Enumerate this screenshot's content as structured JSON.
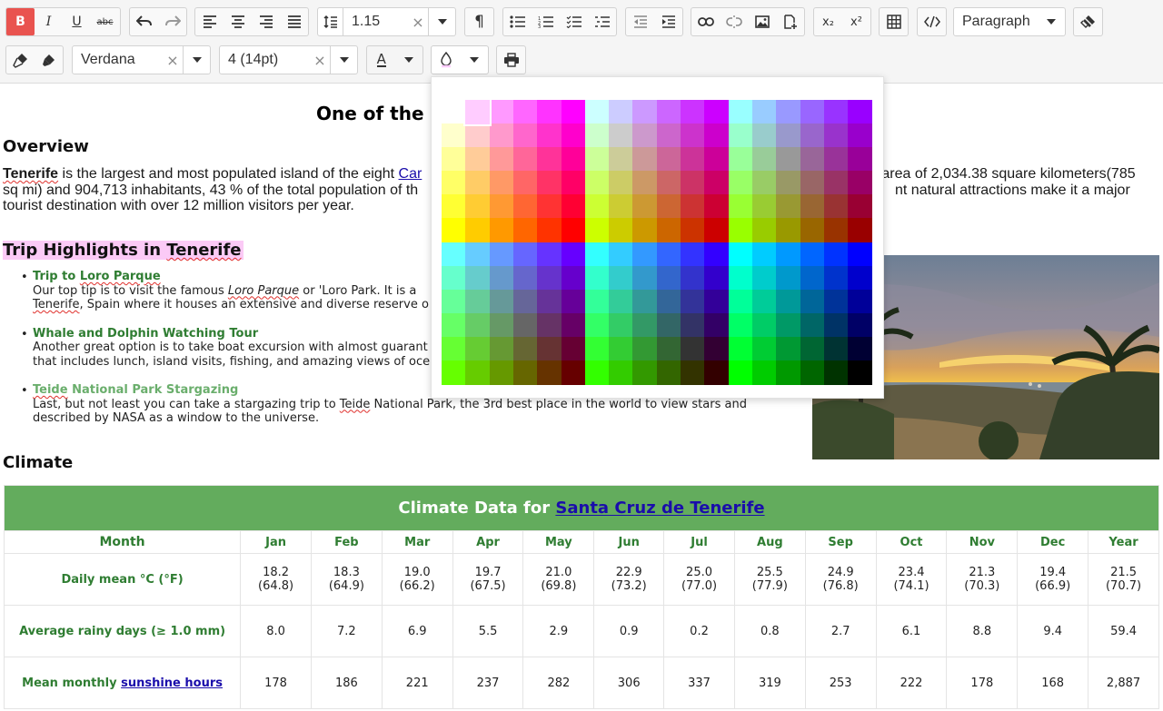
{
  "toolbar": {
    "row1": {
      "line_height_value": "1.15",
      "block_format": "Paragraph"
    },
    "row2": {
      "font_family": "Verdana",
      "font_size": "4 (14pt)",
      "font_color_glyph": "A"
    },
    "icons": {
      "bold": "B",
      "italic": "I",
      "underline": "U",
      "strike": "abc",
      "paragraph_mark": "¶",
      "subscript": "x₂",
      "superscript": "x²",
      "clear": "×"
    }
  },
  "document": {
    "title": "One of the l",
    "overview_heading": "Overview",
    "overview_paragraph": {
      "line1_a": "Tenerife",
      "line1_b": " is the largest and most populated island of the eight ",
      "line1_link": "Car",
      "line1_c": "d area of 2,034.38 square kilometers(785",
      "line2_a": "sq mi) and 904,713 inhabitants, 43 % of the total population of th",
      "line2_b": "nt natural attractions make it a major",
      "line3": "tourist destination with over 12 million visitors per year."
    },
    "highlights_heading": {
      "prefix": "Trip Highlights in ",
      "place": "Tenerife"
    },
    "highlights": [
      {
        "title_a": "Trip to ",
        "title_b": "Loro Parque",
        "line1_a": "Our top tip is to visit the famous ",
        "line1_italic": "Loro Parque",
        "line1_b": " or 'Loro Park. It is a",
        "line2_a": "Tenerife",
        "line2_b": ", Spain where it houses an extensive and diverse reserve o"
      },
      {
        "title": "Whale and Dolphin Watching Tour",
        "line1": "Another great option is to take boat excursion with almost guarant",
        "line2": "that includes lunch, island visits, fishing, and amazing views of oce"
      },
      {
        "title_a": "Teide",
        "title_b": " National Park Stargazing",
        "line1_a": "Last, but not least you can take a stargazing trip to ",
        "line1_b": "Teide",
        "line1_c": " National Park, the 3rd best place in the world to view stars and",
        "line2": "described by NASA as a window to the universe."
      }
    ],
    "climate_heading": "Climate",
    "climate_table": {
      "caption_prefix": "Climate Data for ",
      "caption_link": "Santa Cruz de Tenerife",
      "header_first": "Month",
      "months": [
        "Jan",
        "Feb",
        "Mar",
        "Apr",
        "May",
        "Jun",
        "Jul",
        "Aug",
        "Sep",
        "Oct",
        "Nov",
        "Dec",
        "Year"
      ],
      "rows": [
        {
          "label": "Daily mean °C (°F)",
          "cells": [
            [
              "18.2",
              "(64.8)"
            ],
            [
              "18.3",
              "(64.9)"
            ],
            [
              "19.0",
              "(66.2)"
            ],
            [
              "19.7",
              "(67.5)"
            ],
            [
              "21.0",
              "(69.8)"
            ],
            [
              "22.9",
              "(73.2)"
            ],
            [
              "25.0",
              "(77.0)"
            ],
            [
              "25.5",
              "(77.9)"
            ],
            [
              "24.9",
              "(76.8)"
            ],
            [
              "23.4",
              "(74.1)"
            ],
            [
              "21.3",
              "(70.3)"
            ],
            [
              "19.4",
              "(66.9)"
            ],
            [
              "21.5",
              "(70.7)"
            ]
          ]
        },
        {
          "label": "Average rainy days (≥ 1.0 mm)",
          "cells": [
            "8.0",
            "7.2",
            "6.9",
            "5.5",
            "2.9",
            "0.9",
            "0.2",
            "0.8",
            "2.7",
            "6.1",
            "8.8",
            "9.4",
            "59.4"
          ]
        },
        {
          "label_prefix": "Mean monthly ",
          "label_link": "sunshine hours",
          "cells": [
            "178",
            "186",
            "221",
            "237",
            "282",
            "306",
            "337",
            "319",
            "253",
            "222",
            "178",
            "168",
            "2,887"
          ]
        }
      ]
    }
  },
  "color_palette": {
    "colors": [
      [
        "#ffffff",
        "#ffccff",
        "#ff99ff",
        "#ff66ff",
        "#ff33ff",
        "#ff00ff",
        "#ccffff",
        "#ccccff",
        "#cc99ff",
        "#cc66ff",
        "#cc33ff",
        "#cc00ff",
        "#99ffff",
        "#99ccff",
        "#9999ff",
        "#9966ff",
        "#9933ff",
        "#9900ff"
      ],
      [
        "#ffffcc",
        "#ffcccc",
        "#ff99cc",
        "#ff66cc",
        "#ff33cc",
        "#ff00cc",
        "#ccffcc",
        "#cccccc",
        "#cc99cc",
        "#cc66cc",
        "#cc33cc",
        "#cc00cc",
        "#99ffcc",
        "#99cccc",
        "#9999cc",
        "#9966cc",
        "#9933cc",
        "#9900cc"
      ],
      [
        "#ffff99",
        "#ffcc99",
        "#ff9999",
        "#ff6699",
        "#ff3399",
        "#ff0099",
        "#ccff99",
        "#cccc99",
        "#cc9999",
        "#cc6699",
        "#cc3399",
        "#cc0099",
        "#99ff99",
        "#99cc99",
        "#999999",
        "#996699",
        "#993399",
        "#990099"
      ],
      [
        "#ffff66",
        "#ffcc66",
        "#ff9966",
        "#ff6666",
        "#ff3366",
        "#ff0066",
        "#ccff66",
        "#cccc66",
        "#cc9966",
        "#cc6666",
        "#cc3366",
        "#cc0066",
        "#99ff66",
        "#99cc66",
        "#999966",
        "#996666",
        "#993366",
        "#990066"
      ],
      [
        "#ffff33",
        "#ffcc33",
        "#ff9933",
        "#ff6633",
        "#ff3333",
        "#ff0033",
        "#ccff33",
        "#cccc33",
        "#cc9933",
        "#cc6633",
        "#cc3333",
        "#cc0033",
        "#99ff33",
        "#99cc33",
        "#999933",
        "#996633",
        "#993333",
        "#990033"
      ],
      [
        "#ffff00",
        "#ffcc00",
        "#ff9900",
        "#ff6600",
        "#ff3300",
        "#ff0000",
        "#ccff00",
        "#cccc00",
        "#cc9900",
        "#cc6600",
        "#cc3300",
        "#cc0000",
        "#99ff00",
        "#99cc00",
        "#999900",
        "#996600",
        "#993300",
        "#990000"
      ],
      [
        "#66ffff",
        "#66ccff",
        "#6699ff",
        "#6666ff",
        "#6633ff",
        "#6600ff",
        "#33ffff",
        "#33ccff",
        "#3399ff",
        "#3366ff",
        "#3333ff",
        "#3300ff",
        "#00ffff",
        "#00ccff",
        "#0099ff",
        "#0066ff",
        "#0033ff",
        "#0000ff"
      ],
      [
        "#66ffcc",
        "#66cccc",
        "#6699cc",
        "#6666cc",
        "#6633cc",
        "#6600cc",
        "#33ffcc",
        "#33cccc",
        "#3399cc",
        "#3366cc",
        "#3333cc",
        "#3300cc",
        "#00ffcc",
        "#00cccc",
        "#0099cc",
        "#0066cc",
        "#0033cc",
        "#0000cc"
      ],
      [
        "#66ff99",
        "#66cc99",
        "#669999",
        "#666699",
        "#663399",
        "#660099",
        "#33ff99",
        "#33cc99",
        "#339999",
        "#336699",
        "#333399",
        "#330099",
        "#00ff99",
        "#00cc99",
        "#009999",
        "#006699",
        "#003399",
        "#000099"
      ],
      [
        "#66ff66",
        "#66cc66",
        "#669966",
        "#666666",
        "#663366",
        "#660066",
        "#33ff66",
        "#33cc66",
        "#339966",
        "#336666",
        "#333366",
        "#330066",
        "#00ff66",
        "#00cc66",
        "#009966",
        "#006666",
        "#003366",
        "#000066"
      ],
      [
        "#66ff33",
        "#66cc33",
        "#669933",
        "#666633",
        "#663333",
        "#660033",
        "#33ff33",
        "#33cc33",
        "#339933",
        "#336633",
        "#333333",
        "#330033",
        "#00ff33",
        "#00cc33",
        "#009933",
        "#006633",
        "#003333",
        "#000033"
      ],
      [
        "#66ff00",
        "#66cc00",
        "#669900",
        "#666600",
        "#663300",
        "#660000",
        "#33ff00",
        "#33cc00",
        "#339900",
        "#336600",
        "#333300",
        "#330000",
        "#00ff00",
        "#00cc00",
        "#009900",
        "#006600",
        "#003300",
        "#000000"
      ]
    ],
    "selected": "#ffccff"
  }
}
